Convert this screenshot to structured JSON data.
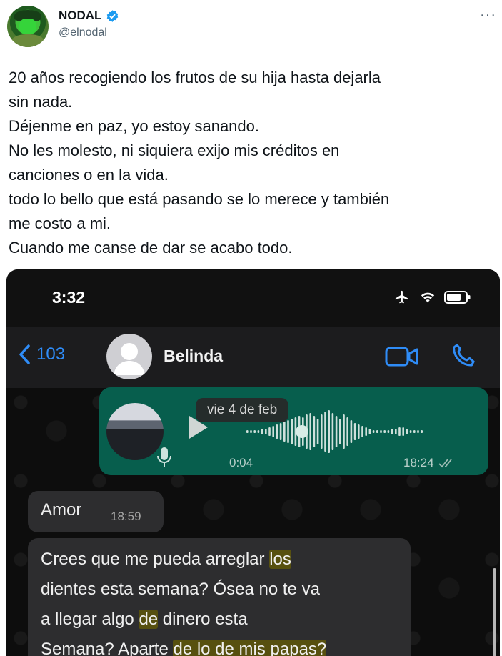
{
  "tweet": {
    "display_name": "NODAL",
    "handle": "@elnodal",
    "more_icon": "more-horizontal-icon",
    "text_lines": [
      "20 años recogiendo los frutos de su hija hasta dejarla",
      "sin nada.",
      "Déjenme en paz, yo estoy sanando.",
      "No les molesto, ni siquiera exijo mis créditos en",
      "canciones o en la vida.",
      "todo lo bello que está pasando se lo merece y también",
      "me costo a mi.",
      "Cuando me canse de dar se acabo todo."
    ]
  },
  "screenshot": {
    "status_time": "3:32",
    "back_count": "103",
    "contact_name": "Belinda",
    "voice_note": {
      "duration": "0:04",
      "sent_time": "18:24",
      "progress": 0.0
    },
    "date_pill": "vie 4 de feb",
    "messages": {
      "amor_text": "Amor",
      "amor_time": "18:59",
      "long": {
        "l1a": "Crees que me pueda arreglar ",
        "l1b": "los",
        "l2": "dientes esta semana? Ósea no te va",
        "l3a": "a llegar algo ",
        "l3b": "de",
        "l3c": " dinero esta",
        "l4a": "Semana? Aparte ",
        "l4b": "de lo de mis papas?"
      }
    },
    "colors": {
      "accent_blue": "#2f8cf7",
      "outgoing_bubble": "#075e4d",
      "incoming_bubble": "#2d2d2f",
      "highlight": "#57500f"
    }
  }
}
